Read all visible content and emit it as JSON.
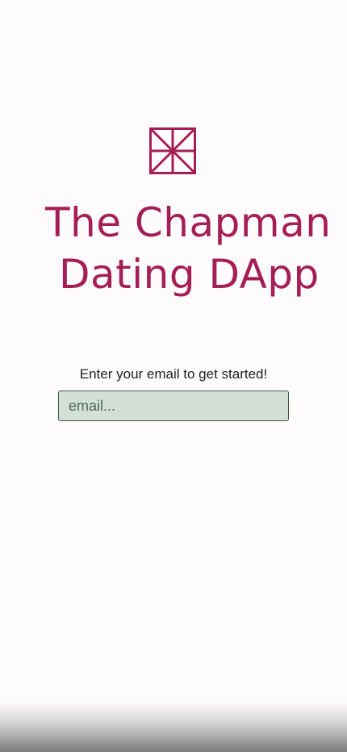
{
  "app": {
    "logo_icon": "square-star-grid-icon",
    "brand_color": "#a51f56",
    "title_line1": "The Chapman",
    "title_line2": "Dating DApp"
  },
  "signup": {
    "prompt": "Enter your email to get started!",
    "email_placeholder": "email...",
    "email_value": "",
    "input_background": "#d4e0d7",
    "input_border": "#3d5a48"
  }
}
